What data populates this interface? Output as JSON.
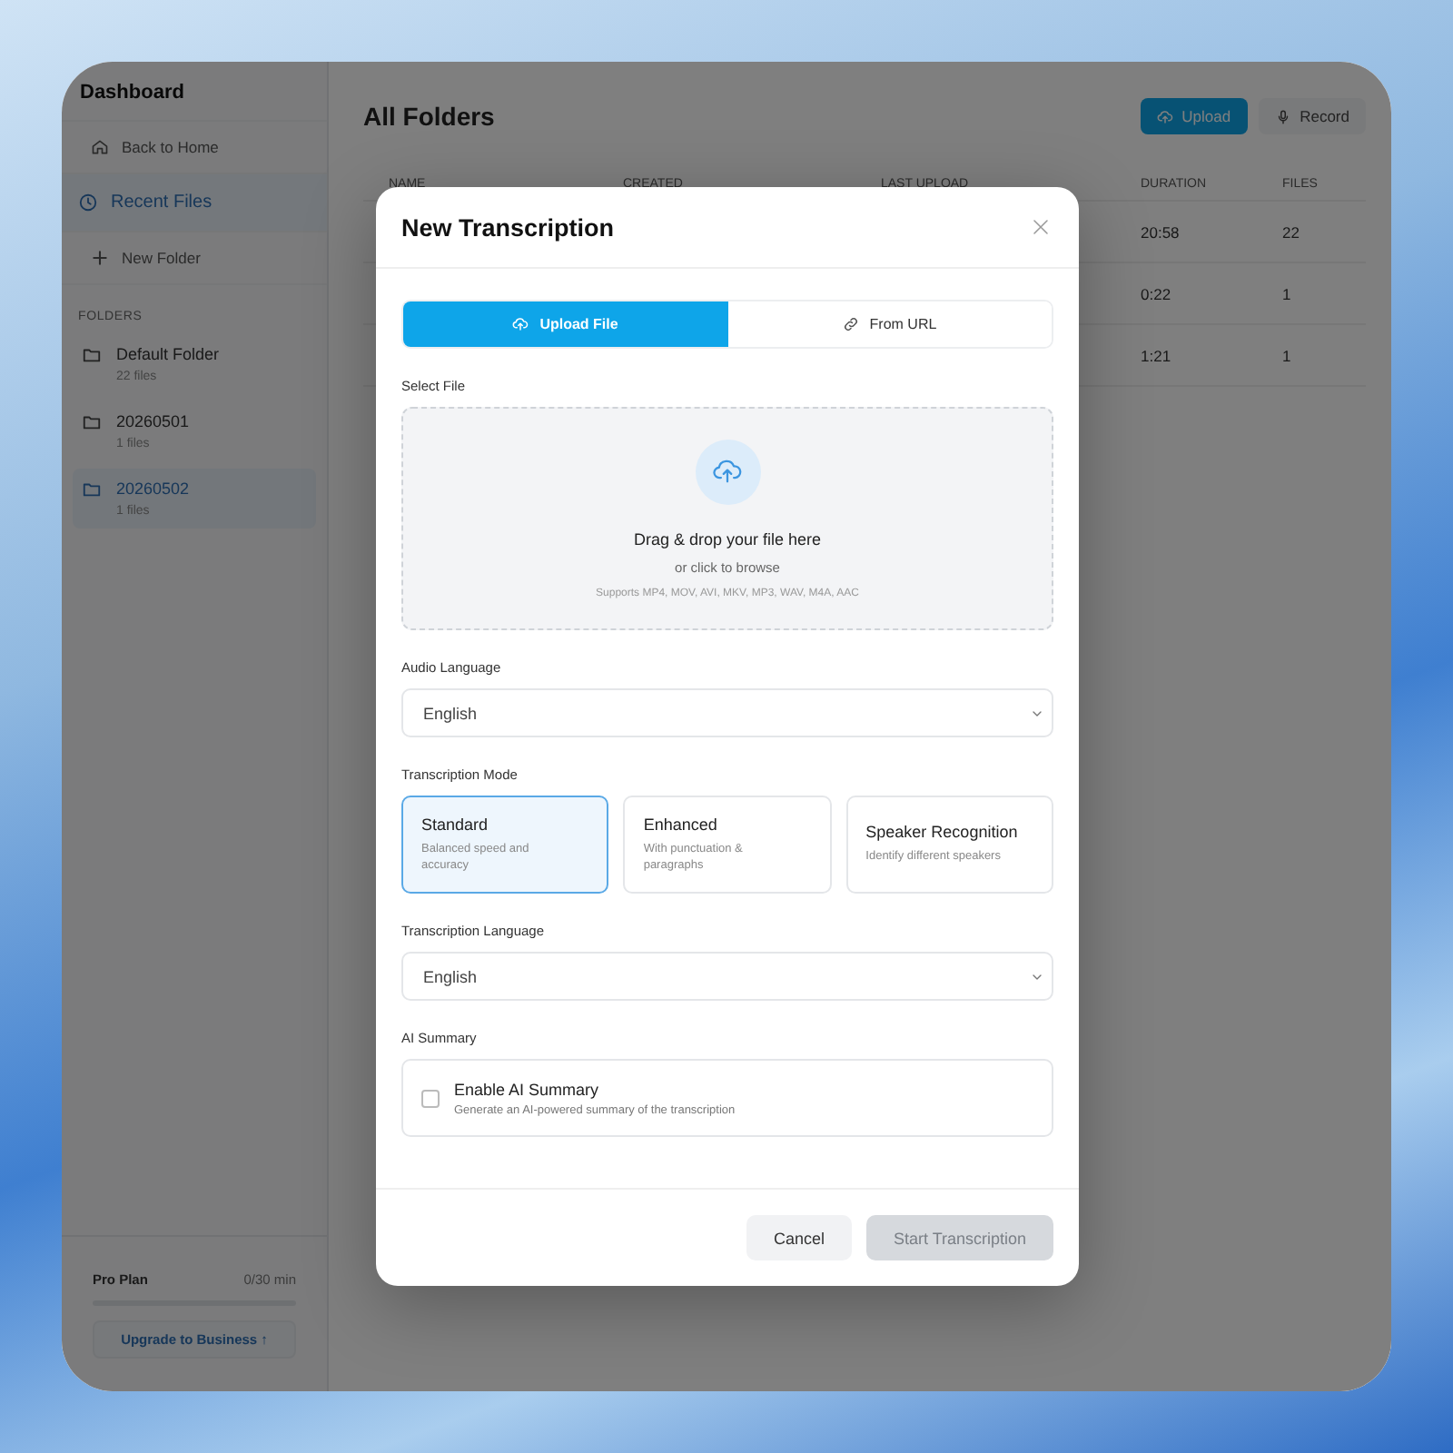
{
  "sidebar": {
    "title": "Dashboard",
    "nav": [
      {
        "label": "Back to Home",
        "kind": "home",
        "selected": false
      },
      {
        "label": "Recent Files",
        "kind": "recent",
        "selected": true
      },
      {
        "label": "New Folder",
        "kind": "add",
        "selected": false
      }
    ],
    "folders_heading": "FOLDERS",
    "folders": [
      {
        "name": "Default Folder",
        "count": "22 files",
        "selected": false
      },
      {
        "name": "20260501",
        "count": "1 files",
        "selected": false
      },
      {
        "name": "20260502",
        "count": "1 files",
        "selected": true
      }
    ],
    "plan": {
      "name": "Pro Plan",
      "usage": "0/30 min",
      "level": 0
    },
    "upgrade": "Upgrade to Business ↑"
  },
  "main": {
    "title": "All Folders",
    "actions": [
      {
        "label": "Upload",
        "kind": "upload"
      },
      {
        "label": "Record",
        "kind": "record"
      }
    ],
    "table": {
      "columns": [
        "NAME",
        "CREATED",
        "LAST UPLOAD",
        "DURATION",
        "FILES"
      ],
      "rows": [
        {
          "duration": "20:58",
          "files": "22"
        },
        {
          "duration": "0:22",
          "files": "1"
        },
        {
          "duration": "1:21",
          "files": "1"
        }
      ]
    }
  },
  "modal": {
    "title": "New Transcription",
    "tabs": [
      {
        "label": "Upload File",
        "kind": "upload",
        "selected": true
      },
      {
        "label": "From URL",
        "kind": "link",
        "selected": false
      }
    ],
    "select_file": {
      "label": "Select File",
      "title": "Drag & drop your file here",
      "subtitle": "or click to browse",
      "formats": "Supports MP4, MOV, AVI, MKV, MP3, WAV, M4A, AAC"
    },
    "audio_language": {
      "label": "Audio Language",
      "value": "English"
    },
    "mode": {
      "label": "Transcription Mode",
      "options": [
        {
          "title": "Standard",
          "description": "Balanced speed and accuracy",
          "selected": true
        },
        {
          "title": "Enhanced",
          "description": "With punctuation & paragraphs",
          "selected": false
        },
        {
          "title": "Speaker Recognition",
          "description": "Identify different speakers",
          "selected": false
        }
      ]
    },
    "transcription_language": {
      "label": "Transcription Language",
      "value": "English"
    },
    "ai_summary": {
      "label": "AI Summary",
      "title": "Enable AI Summary",
      "description": "Generate an AI-powered summary of the transcription",
      "checked": false
    },
    "buttons": [
      {
        "label": "Cancel",
        "kind": "secondary",
        "disabled": false
      },
      {
        "label": "Start Transcription",
        "kind": "primary",
        "disabled": true
      }
    ]
  }
}
